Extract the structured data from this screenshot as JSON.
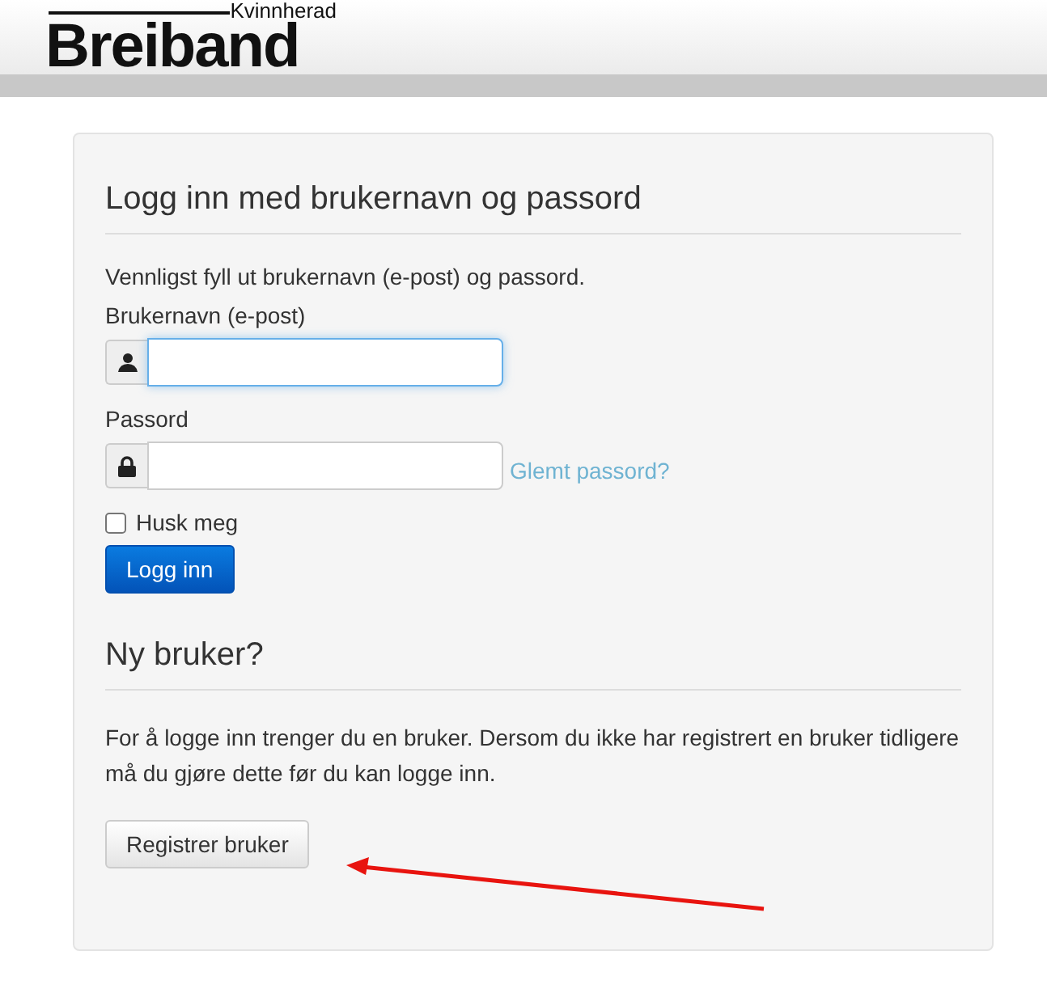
{
  "header": {
    "logo_small": "Kvinnherad",
    "logo_large": "Breiband"
  },
  "login": {
    "title": "Logg inn med brukernavn og passord",
    "intro": "Vennligst fyll ut brukernavn (e-post) og passord.",
    "fields": [
      {
        "kind": "user",
        "label": "Brukernavn (e-post)",
        "focused": true
      },
      {
        "kind": "lock",
        "label": "Passord",
        "focused": false,
        "link": "Glemt passord?"
      }
    ],
    "remember": {
      "label": "Husk meg",
      "checked": false
    },
    "submit": "Logg inn"
  },
  "register": {
    "title": "Ny bruker?",
    "text": "For å logge inn trenger du en bruker. Dersom du ikke har registrert en bruker tidligere må du gjøre dette før du kan logge inn.",
    "button": "Registrer bruker"
  }
}
